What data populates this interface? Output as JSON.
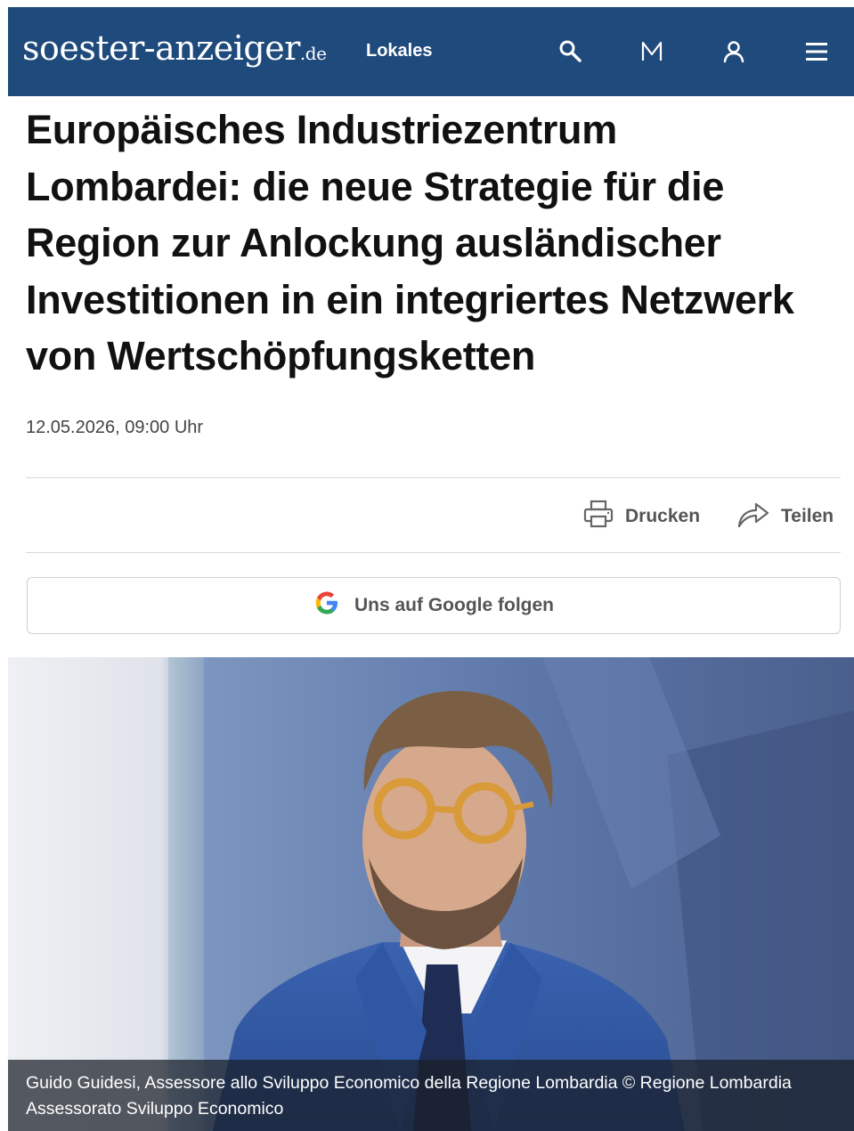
{
  "header": {
    "logo_name": "soester-anzeiger",
    "logo_tld": ".de",
    "nav_lokales": "Lokales",
    "icons": [
      "search-icon",
      "merkliste-m-icon",
      "user-icon",
      "menu-icon"
    ],
    "background_color": "#1f4a7c"
  },
  "article": {
    "title": "Europäisches Industriezentrum Lombardei: die neue Strategie für die Region zur Anlockung ausländischer Investitionen in ein integriertes Netzwerk von Wertschöpfungsketten",
    "date": "12.05.2026, 09:00 Uhr"
  },
  "actions": {
    "print_label": "Drucken",
    "share_label": "Teilen"
  },
  "google_follow": {
    "label": "Uns auf Google folgen",
    "icon": "google-g-icon"
  },
  "image": {
    "caption": "Guido Guidesi, Assessore allo Sviluppo Economico della Regione Lombardia © Regione Lombardia Assessorato Sviluppo Economico"
  }
}
